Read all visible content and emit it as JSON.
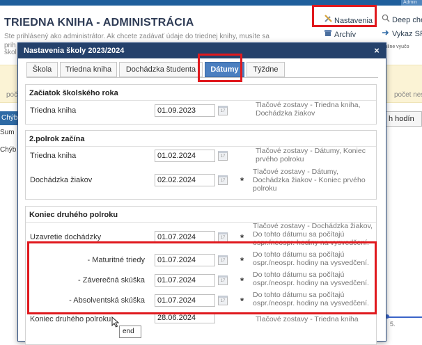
{
  "background": {
    "admin_tab": "Admin",
    "title": "TRIEDNA KNIHA - ADMINISTRÁCIA",
    "subtitle": "Ste prihlásený ako administrátor. Ak chcete zadávať údaje do triednej knihy, musíte sa",
    "subtitle_line2": "prih",
    "subtitle_line3": "škol",
    "links": {
      "settings": "Nastavenia",
      "archive": "Archív",
      "deep": "Deep che",
      "vykaz": "Vykaz SP",
      "online": "Online vyučo"
    },
    "left_poc": "poč",
    "right_poc": "počet nes",
    "left_tab": "Chýb",
    "left_sum": "Sum",
    "left_chyb": "Chýb",
    "right_button": "h hodín",
    "axis_five": "5."
  },
  "dialog": {
    "title": "Nastavenia školy 2023/2024",
    "close": "×",
    "tabs": [
      {
        "label": "Škola"
      },
      {
        "label": "Triedna kniha"
      },
      {
        "label": "Dochádzka študenta"
      },
      {
        "label": "Dátumy"
      },
      {
        "label": "Týždne"
      }
    ],
    "sections": {
      "start": {
        "header": "Začiatok školského roka",
        "rows": [
          {
            "label": "Triedna kniha",
            "date": "01.09.2023",
            "star": "",
            "note": "Tlačové zostavy - Triedna kniha, Dochádzka žiakov"
          }
        ]
      },
      "second": {
        "header": "2.polrok začína",
        "rows": [
          {
            "label": "Triedna kniha",
            "date": "01.02.2024",
            "star": "",
            "note": "Tlačové zostavy - Dátumy, Koniec prvého polroku"
          },
          {
            "label": "Dochádzka žiakov",
            "date": "02.02.2024",
            "star": "*",
            "note": "Tlačové zostavy - Dátumy, Dochádzka žiakov - Koniec prvého polroku"
          }
        ]
      },
      "end": {
        "header": "Koniec druhého polroku",
        "rows": [
          {
            "label": "Uzavretie dochádzky",
            "date": "01.07.2024",
            "star": "*",
            "note": "Tlačové zostavy - Dochádzka žiakov, Do tohto dátumu sa počítajú ospr./neospr. hodiny na vysvedčení."
          },
          {
            "label": "- Maturitné triedy",
            "date": "01.07.2024",
            "star": "*",
            "note": "Do tohto dátumu sa počítajú ospr./neospr. hodiny na vysvedčení."
          },
          {
            "label": "- Záverečná skúška",
            "date": "01.07.2024",
            "star": "*",
            "note": "Do tohto dátumu sa počítajú ospr./neospr. hodiny na vysvedčení."
          },
          {
            "label": "- Absolventská skúška",
            "date": "01.07.2024",
            "star": "*",
            "note": "Do tohto dátumu sa počítajú ospr./neospr. hodiny na vysvedčení."
          },
          {
            "label": "Koniec druhého polroku",
            "date": "28.06.2024",
            "star": "",
            "note": "Tlačové zostavy - Triedna kniha"
          }
        ]
      }
    },
    "calendar_glyph": "17"
  },
  "tooltip": "end",
  "colors": {
    "header_bg": "#24416b",
    "active_tab": "#4b7fc0",
    "highlight_red": "#e0191e"
  }
}
